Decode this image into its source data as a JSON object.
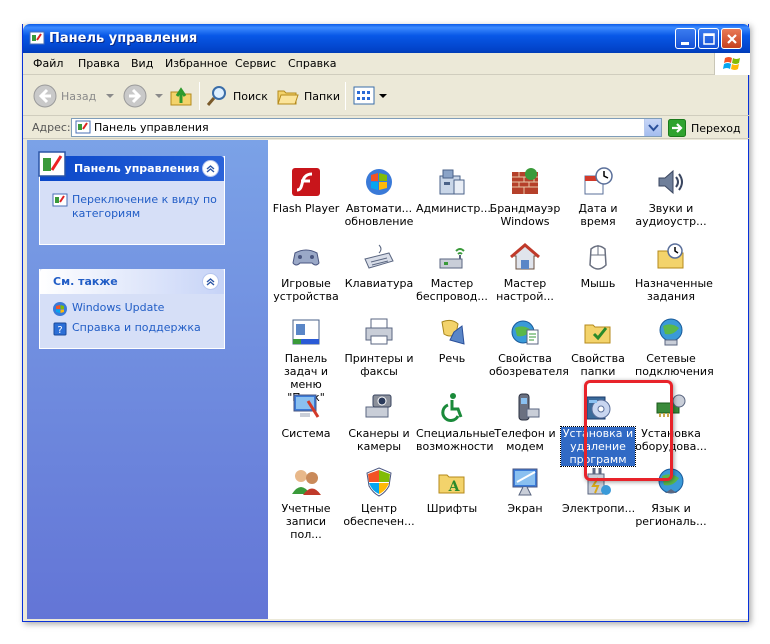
{
  "window": {
    "title": "Панель управления"
  },
  "menu": [
    "Файл",
    "Правка",
    "Вид",
    "Избранное",
    "Сервис",
    "Справка"
  ],
  "toolbar": {
    "back": "Назад",
    "search": "Поиск",
    "folders": "Папки"
  },
  "address": {
    "label": "Адрес:",
    "value": "Панель управления",
    "go": "Переход"
  },
  "sidebar": {
    "panel_title": "Панель управления",
    "switch_view": "Переключение к виду по категориям",
    "see_also_title": "См. также",
    "see_also": [
      "Windows Update",
      "Справка и поддержка"
    ]
  },
  "items": [
    [
      "Flash Player",
      "Автомати... обновление",
      "Администр...",
      "Брандмауэр Windows",
      "Дата и время",
      "Звуки и аудиоустр..."
    ],
    [
      "Игровые устройства",
      "Клавиатура",
      "Мастер беспровод...",
      "Мастер настрой...",
      "Мышь",
      "Назначенные задания"
    ],
    [
      "Панель задач и меню \"Пуск\"",
      "Принтеры и факсы",
      "Речь",
      "Свойства обозревателя",
      "Свойства папки",
      "Сетевые подключения"
    ],
    [
      "Система",
      "Сканеры и камеры",
      "Специальные возможности",
      "Телефон и модем",
      "Установка и удаление программ",
      "Установка оборудова..."
    ],
    [
      "Учетные записи пол...",
      "Центр обеспечен...",
      "Шрифты",
      "Экран",
      "Электропи...",
      "Язык и региональ..."
    ]
  ],
  "icons": [
    [
      "flash-player-icon",
      "automatic-updates-icon",
      "administrative-tools-icon",
      "firewall-icon",
      "date-time-icon",
      "sounds-icon"
    ],
    [
      "game-controllers-icon",
      "keyboard-icon",
      "wireless-wizard-icon",
      "network-setup-icon",
      "mouse-icon",
      "scheduled-tasks-icon"
    ],
    [
      "taskbar-icon",
      "printers-icon",
      "speech-icon",
      "internet-options-icon",
      "folder-options-icon",
      "network-connections-icon"
    ],
    [
      "system-icon",
      "scanners-cameras-icon",
      "accessibility-icon",
      "phone-modem-icon",
      "add-remove-programs-icon",
      "add-hardware-icon"
    ],
    [
      "user-accounts-icon",
      "security-center-icon",
      "fonts-icon",
      "display-icon",
      "power-options-icon",
      "regional-language-icon"
    ]
  ],
  "colors": {
    "title_bar": "#0a5ae8",
    "side_panel": "#6d8fe0",
    "selection": "#316ac5",
    "highlight_frame": "#e8232a"
  }
}
